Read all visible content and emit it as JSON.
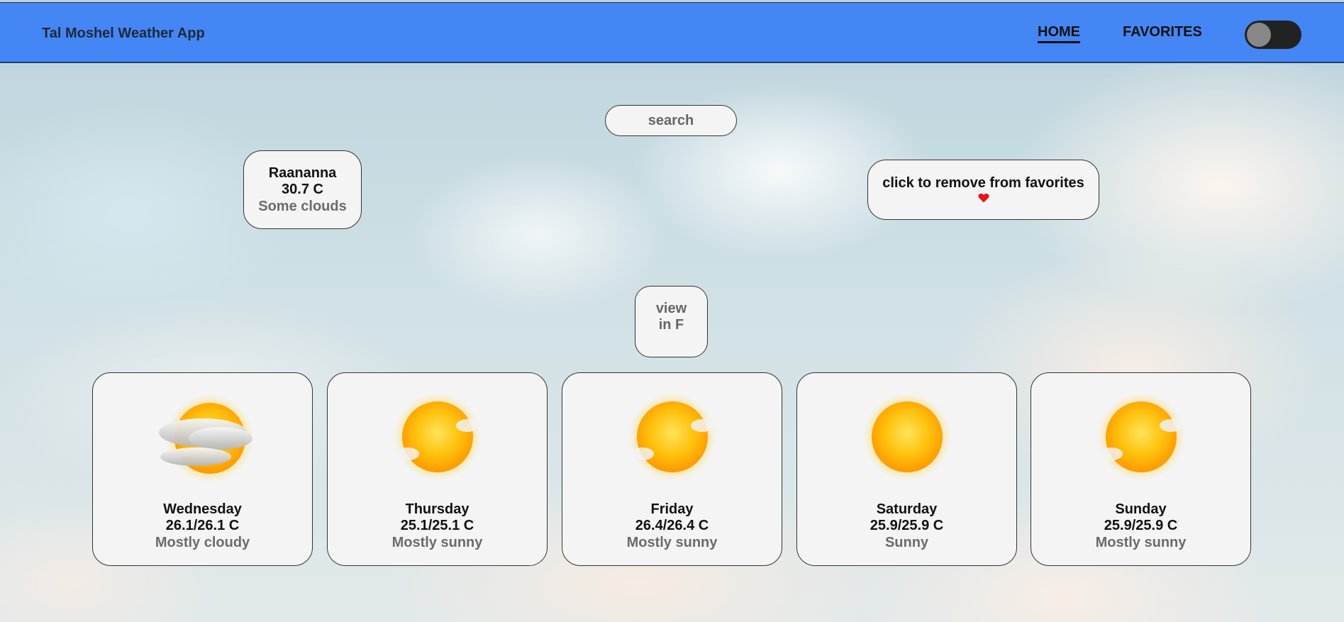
{
  "header": {
    "brand": "Tal Moshel Weather App",
    "nav": [
      {
        "label": "HOME",
        "active": true
      },
      {
        "label": "FAVORITES",
        "active": false
      }
    ],
    "theme_toggle": {
      "on": false
    }
  },
  "search": {
    "placeholder": "search",
    "value": ""
  },
  "current": {
    "city": "Raananna",
    "temperature": "30.7 C",
    "condition": "Some clouds"
  },
  "favorite": {
    "label": "click to remove from favorites",
    "icon": "heart-icon",
    "color": "#e8141c"
  },
  "unit_toggle": {
    "line1": "view",
    "line2": "in F"
  },
  "forecast": [
    {
      "day": "Wednesday",
      "temp": "26.1/26.1 C",
      "condition": "Mostly cloudy",
      "icon": "mostly-cloudy-icon"
    },
    {
      "day": "Thursday",
      "temp": "25.1/25.1 C",
      "condition": "Mostly sunny",
      "icon": "mostly-sunny-icon"
    },
    {
      "day": "Friday",
      "temp": "26.4/26.4 C",
      "condition": "Mostly sunny",
      "icon": "mostly-sunny-icon"
    },
    {
      "day": "Saturday",
      "temp": "25.9/25.9 C",
      "condition": "Sunny",
      "icon": "sunny-icon"
    },
    {
      "day": "Sunday",
      "temp": "25.9/25.9 C",
      "condition": "Mostly sunny",
      "icon": "mostly-sunny-icon"
    }
  ],
  "colors": {
    "header": "#4586f5",
    "card": "#f4f4f4",
    "muted_text": "#6b6b6b"
  }
}
